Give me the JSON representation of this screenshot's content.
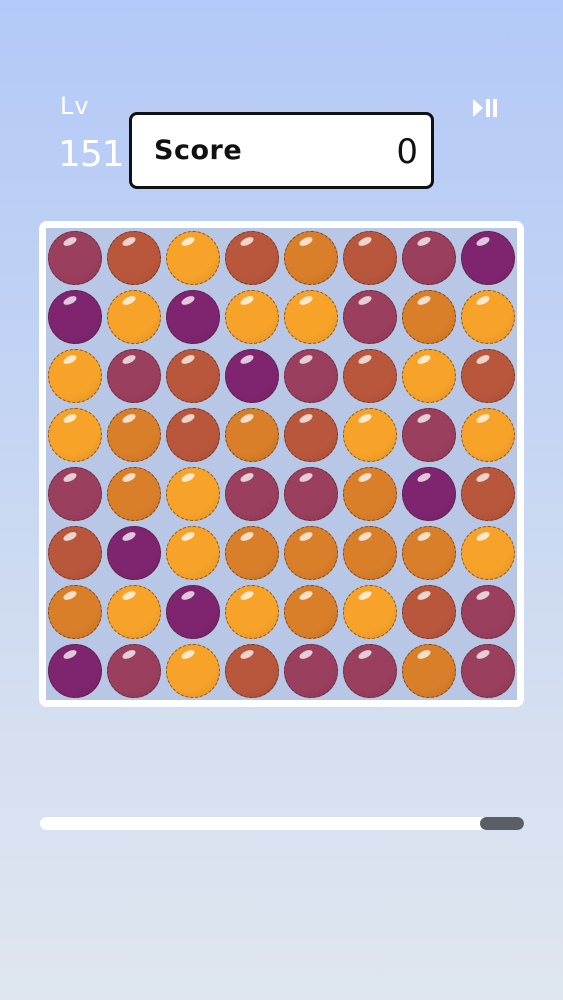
{
  "hud": {
    "level_label": "Lv",
    "level_value": "151",
    "score_label": "Score",
    "score_value": "0",
    "play_pause_icon": "play-pause-icon"
  },
  "colors": {
    "purple": "#7f2570",
    "plum": "#9b3f5e",
    "rust": "#b9573d",
    "orange": "#d97f2a",
    "amber": "#f7a32a"
  },
  "board": {
    "rows": 8,
    "cols": 8,
    "grid": [
      [
        "plum",
        "rust",
        "amber",
        "rust",
        "orange",
        "rust",
        "plum",
        "purple"
      ],
      [
        "purple",
        "amber",
        "purple",
        "amber",
        "amber",
        "plum",
        "orange",
        "amber"
      ],
      [
        "amber",
        "plum",
        "rust",
        "purple",
        "plum",
        "rust",
        "amber",
        "rust"
      ],
      [
        "amber",
        "orange",
        "rust",
        "orange",
        "rust",
        "amber",
        "plum",
        "amber"
      ],
      [
        "plum",
        "orange",
        "amber",
        "plum",
        "plum",
        "orange",
        "purple",
        "rust"
      ],
      [
        "rust",
        "purple",
        "amber",
        "orange",
        "orange",
        "orange",
        "orange",
        "amber"
      ],
      [
        "orange",
        "amber",
        "purple",
        "amber",
        "orange",
        "amber",
        "rust",
        "plum"
      ],
      [
        "purple",
        "plum",
        "amber",
        "rust",
        "plum",
        "plum",
        "orange",
        "plum"
      ]
    ]
  },
  "timer": {
    "remaining_fraction": 0.09
  }
}
